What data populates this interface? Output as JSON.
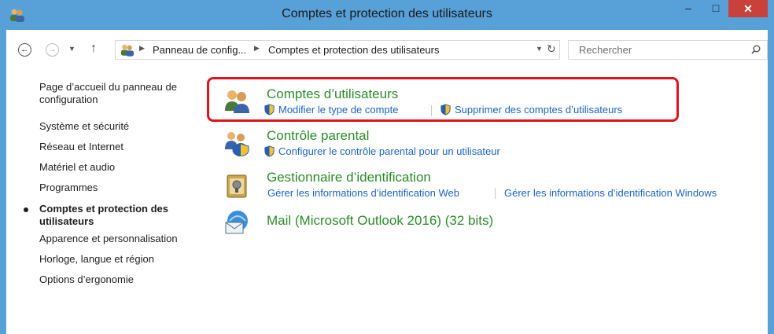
{
  "window": {
    "title": "Comptes et protection des utilisateurs",
    "minimize_glyph": "–",
    "maximize_glyph": "□",
    "close_glyph": "✕"
  },
  "address_bar": {
    "crumbs": [
      "Panneau de config...",
      "Comptes et protection des utilisateurs"
    ],
    "search_placeholder": "Rechercher"
  },
  "sidebar": {
    "home_label": "Page d’accueil du panneau de configuration",
    "items": [
      {
        "label": "Système et sécurité"
      },
      {
        "label": "Réseau et Internet"
      },
      {
        "label": "Matériel et audio"
      },
      {
        "label": "Programmes"
      },
      {
        "label": "Comptes et protection des utilisateurs",
        "current": true
      },
      {
        "label": "Apparence et personnalisation"
      },
      {
        "label": "Horloge, langue et région"
      },
      {
        "label": "Options d’ergonomie"
      }
    ]
  },
  "categories": [
    {
      "title": "Comptes d’utilisateurs",
      "icon": "user-accounts-icon",
      "links": [
        "Modifier le type de compte",
        "Supprimer des comptes d’utilisateurs"
      ],
      "highlighted": true
    },
    {
      "title": "Contrôle parental",
      "icon": "parental-controls-icon",
      "links": [
        "Configurer le contrôle parental pour un utilisateur"
      ]
    },
    {
      "title": "Gestionnaire d’identification",
      "icon": "credential-manager-icon",
      "links": [
        "Gérer les informations d’identification Web",
        "Gérer les informations d’identification Windows"
      ]
    },
    {
      "title": "Mail (Microsoft Outlook 2016) (32 bits)",
      "icon": "mail-icon",
      "links": []
    }
  ],
  "colors": {
    "frame": "#57a0d8",
    "category_title": "#2a8c2a",
    "link": "#1a64c1",
    "highlight": "#e0121f",
    "close_button": "#c8423b"
  }
}
